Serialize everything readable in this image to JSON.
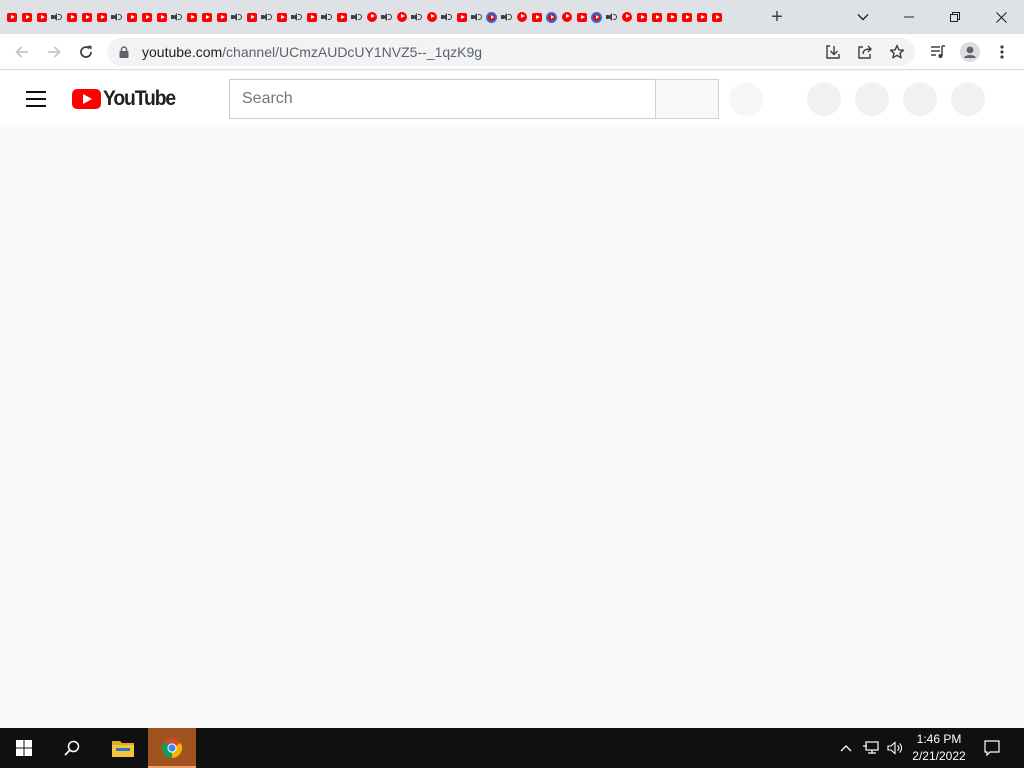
{
  "browser": {
    "tab_favicons": [
      "yt",
      "yt",
      "yt",
      "audio",
      "yt",
      "yt",
      "yt",
      "audio",
      "yt",
      "yt",
      "yt",
      "audio",
      "yt",
      "yt",
      "yt",
      "audio",
      "yt",
      "audio",
      "yt",
      "audio",
      "yt",
      "audio",
      "yt",
      "audio",
      "yt-round",
      "audio",
      "yt-round",
      "audio",
      "yt-round",
      "audio",
      "yt",
      "audio",
      "yt-ring",
      "audio",
      "yt-round",
      "yt",
      "yt-ring",
      "yt-round",
      "yt",
      "yt-ring",
      "audio",
      "yt-round",
      "yt",
      "yt",
      "yt",
      "yt",
      "yt",
      "yt"
    ],
    "new_tab_label": "+",
    "url_host": "youtube.com",
    "url_path": "/channel/UCmzAUDcUY1NVZ5--_1qzK9g",
    "icons": {
      "back": "back-arrow-icon",
      "forward": "forward-arrow-icon",
      "reload": "reload-icon",
      "lock": "lock-icon",
      "install": "install-icon",
      "share": "share-icon",
      "bookmark": "star-icon",
      "media": "media-queue-icon",
      "profile": "profile-icon",
      "menu": "kebab-menu-icon"
    }
  },
  "youtube": {
    "logo_text": "YouTube",
    "search_placeholder": "Search",
    "brand_color": "#ff0000"
  },
  "taskbar": {
    "time": "1:46 PM",
    "date": "2/21/2022",
    "accent_color": "#a0521f"
  }
}
